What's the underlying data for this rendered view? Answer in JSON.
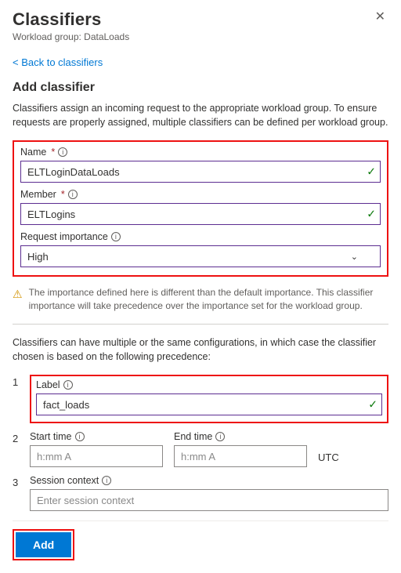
{
  "header": {
    "title": "Classifiers",
    "subtitle": "Workload group: DataLoads",
    "back_link": "< Back to classifiers"
  },
  "section": {
    "heading": "Add classifier",
    "desc": "Classifiers assign an incoming request to the appropriate workload group. To ensure requests are properly assigned, multiple classifiers can be defined per workload group."
  },
  "form": {
    "name_label": "Name",
    "name_value": "ELTLoginDataLoads",
    "member_label": "Member",
    "member_value": "ELTLogins",
    "importance_label": "Request importance",
    "importance_value": "High"
  },
  "warning": "The importance defined here is different than the default importance. This classifier importance will take precedence over the importance set for the workload group.",
  "precedence_intro": "Classifiers can have multiple or the same configurations, in which case the classifier chosen is based on the following precedence:",
  "prec": {
    "n1": "1",
    "label_label": "Label",
    "label_value": "fact_loads",
    "n2": "2",
    "start_label": "Start time",
    "start_ph": "h:mm A",
    "end_label": "End time",
    "end_ph": "h:mm A",
    "utc": "UTC",
    "n3": "3",
    "session_label": "Session context",
    "session_ph": "Enter session context"
  },
  "footer": {
    "add": "Add"
  }
}
